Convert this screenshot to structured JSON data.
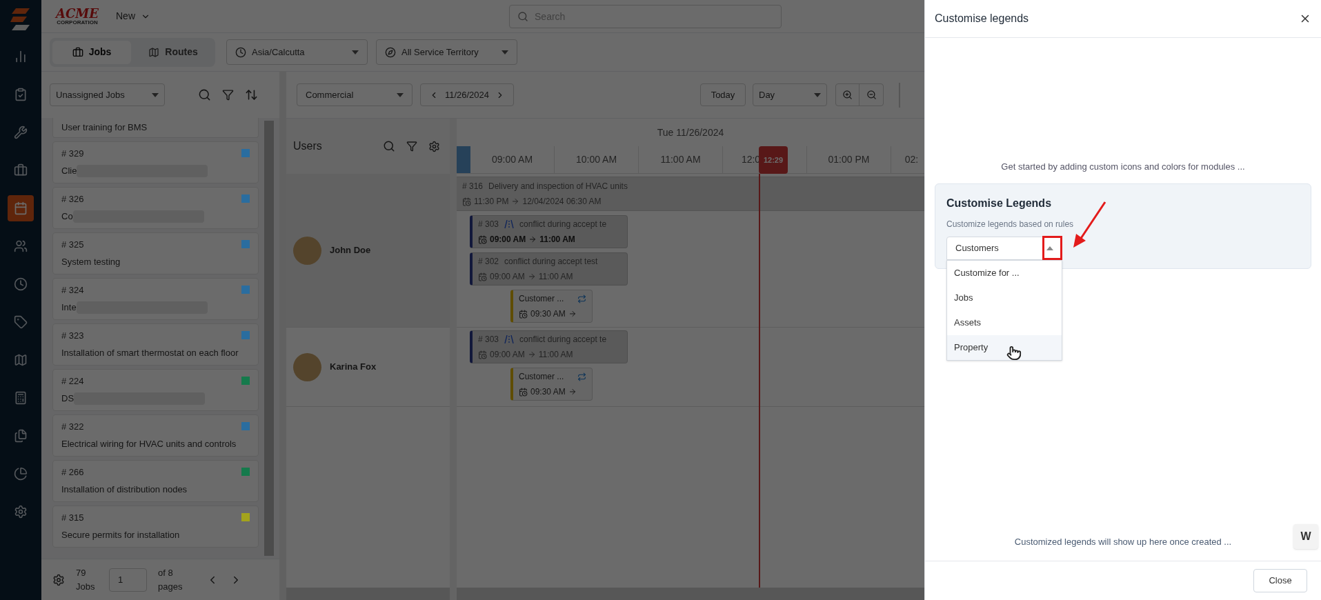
{
  "logo": {
    "name": "ACME",
    "sub": "CORPORATION"
  },
  "new_menu": {
    "label": "New"
  },
  "search": {
    "placeholder": "Search"
  },
  "nav": [
    {
      "selected": false
    },
    {
      "selected": false
    },
    {
      "selected": false
    },
    {
      "selected": false
    },
    {
      "selected": true
    },
    {
      "selected": false
    },
    {
      "selected": false
    },
    {
      "selected": false
    },
    {
      "selected": false
    },
    {
      "selected": false
    },
    {
      "selected": false
    },
    {
      "selected": false
    },
    {
      "selected": false
    }
  ],
  "view_tabs": [
    {
      "label": "Jobs",
      "selected": true
    },
    {
      "label": "Routes",
      "selected": false
    }
  ],
  "timezone": "Asia/Calcutta",
  "territory": "All Service Territory",
  "job_list": {
    "filter": "Unassigned Jobs",
    "jobs": [
      {
        "title": "User training for BMS",
        "redacted": false
      },
      {
        "number": "# 329",
        "title": "Clie",
        "redacted": true,
        "color": "#2a6d9f"
      },
      {
        "number": "# 326",
        "title": "Co",
        "redacted": true,
        "color": "#2a6d9f"
      },
      {
        "number": "# 325",
        "title": "System testing",
        "redacted": false,
        "color": "#2a6d9f"
      },
      {
        "number": "# 324",
        "title": "Inte",
        "redacted": true,
        "color": "#2a6d9f"
      },
      {
        "number": "# 323",
        "title": "Installation of smart thermostat on each floor",
        "redacted": false,
        "color": "#2a6d9f"
      },
      {
        "number": "# 224",
        "title": "DS",
        "redacted": true,
        "color": "#157a4c"
      },
      {
        "number": "# 322",
        "title": "Electrical wiring for HVAC units and controls",
        "redacted": false,
        "color": "#2a6d9f"
      },
      {
        "number": "# 266",
        "title": "Installation of distribution nodes",
        "redacted": false,
        "color": "#157a4c"
      },
      {
        "number": "# 315",
        "title": "Secure permits for installation",
        "redacted": false,
        "color": "#a3a31c"
      }
    ],
    "count": "79 Jobs",
    "page": "1",
    "pages": "of 8 pages"
  },
  "scheduler": {
    "category": "Commercial",
    "date": "11/26/2024",
    "today": "Today",
    "view": "Day",
    "users_title": "Users",
    "day_label": "Tue 11/26/2024",
    "hours": [
      "09:00 AM",
      "10:00 AM",
      "11:00 AM",
      "12:0",
      "01:00 PM",
      "02:"
    ],
    "now": "12:29",
    "users": [
      {
        "name": "John Doe",
        "events": [
          {
            "kind": "span",
            "number": "# 316",
            "title": "Delivery and inspection of HVAC units",
            "start": "11:30 PM",
            "end": "12/04/2024 06:30 AM"
          },
          {
            "kind": "job",
            "number": "# 303",
            "title": "conflict during accept te",
            "route": true,
            "start": "09:00 AM",
            "end": "11:00 AM",
            "bold": true
          },
          {
            "kind": "job",
            "number": "# 302",
            "title": "conflict during accept test",
            "route": false,
            "start": "09:00 AM",
            "end": "11:00 AM",
            "bold": false
          },
          {
            "kind": "task",
            "title": "Customer ...",
            "start": "09:30 AM"
          }
        ]
      },
      {
        "name": "Karina Fox",
        "events": [
          {
            "kind": "job",
            "number": "# 303",
            "title": "conflict during accept te",
            "route": true,
            "start": "09:00 AM",
            "end": "11:00 AM",
            "bold": false
          },
          {
            "kind": "task",
            "title": "Customer ...",
            "start": "09:30 AM"
          }
        ]
      }
    ]
  },
  "drawer": {
    "title": "Customise legends",
    "intro": "Get started by adding custom icons and colors for modules ...",
    "card": {
      "title": "Customise Legends",
      "subtitle": "Customize legends based on rules",
      "value": "Customers",
      "open": true,
      "options": [
        {
          "label": "Customize for ...",
          "highlighted": false
        },
        {
          "label": "Jobs",
          "highlighted": false
        },
        {
          "label": "Assets",
          "highlighted": false
        },
        {
          "label": "Property",
          "highlighted": true
        }
      ]
    },
    "footer_note": "Customized legends will show up here once created ...",
    "close": "Close",
    "widget": "W"
  }
}
